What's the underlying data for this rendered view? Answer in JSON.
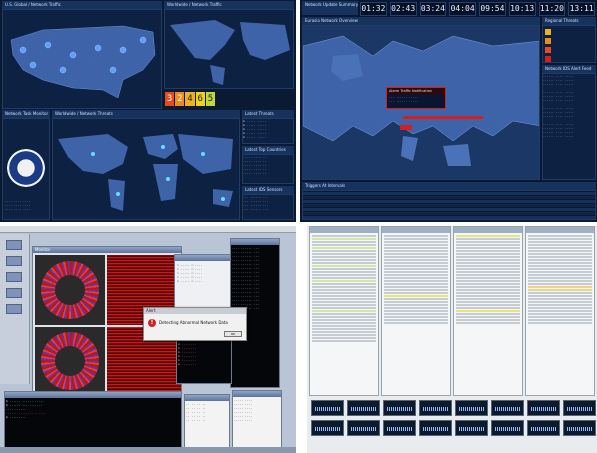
{
  "us_quad": {
    "title_main": "U.S. Global / Network Traffic",
    "title_small_map": "Worldwide / Network Traffic",
    "title_net_health": "Network Task Monitor",
    "title_world": "Worldwide / Network Threats",
    "title_active_threats": "Latest Threats",
    "title_top_countries": "Latest Top Countries",
    "title_ip": "Latest IDS Sensors",
    "counter_digits": [
      "3",
      "2",
      "4",
      "6",
      "5"
    ]
  },
  "eu_quad": {
    "title_header": "Network Update Summary",
    "title_map": "Eurasia Network Overview",
    "alert_label": "Alarm Traffic Notification",
    "title_recent": "Triggers At Intervals",
    "title_right_top": "Regional Threats",
    "title_right_mid": "Network IDS Alert Feed",
    "clocks": [
      "01:32",
      "02:43",
      "03:24",
      "04:04",
      "09:54",
      "10:13",
      "11:20",
      "13:11"
    ]
  },
  "desktop_quad": {
    "window_title": "Monitor",
    "alert_title": "Alert",
    "alert_message": "Detecting Abnormal Network Data",
    "alert_button": "OK"
  },
  "colors": {
    "map_land": "#3e63a8",
    "map_water": "#0b1a33",
    "alert_red": "#d21f1f"
  }
}
